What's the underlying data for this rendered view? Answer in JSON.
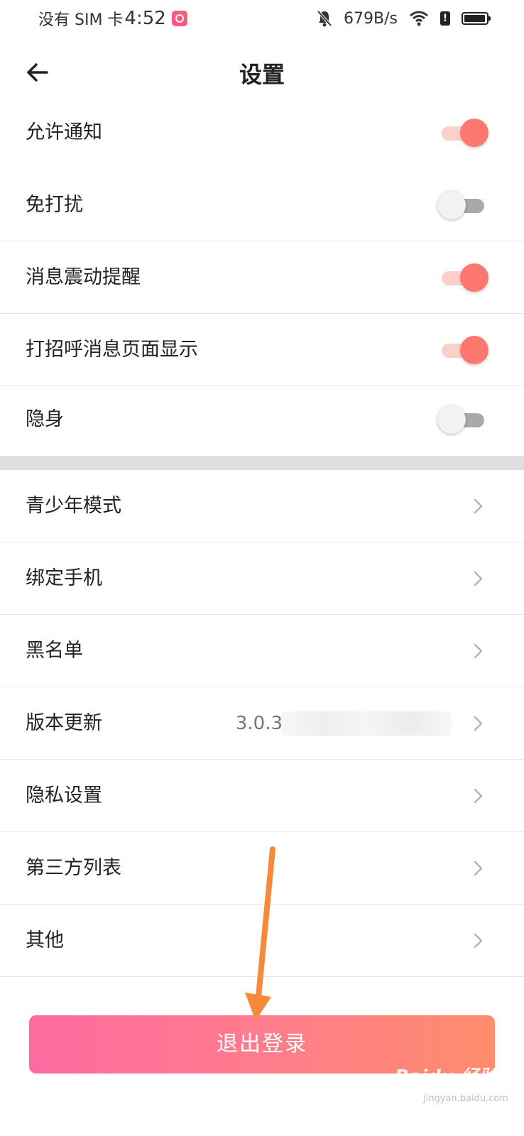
{
  "status_bar": {
    "carrier": "没有 SIM 卡",
    "time": "4:52",
    "net_speed": "679B/s"
  },
  "header": {
    "title": "设置"
  },
  "toggles": [
    {
      "label": "允许通知",
      "on": true
    },
    {
      "label": "免打扰",
      "on": false
    },
    {
      "label": "消息震动提醒",
      "on": true
    },
    {
      "label": "打招呼消息页面显示",
      "on": true
    },
    {
      "label": "隐身",
      "on": false
    }
  ],
  "menu": [
    {
      "label": "青少年模式"
    },
    {
      "label": "绑定手机"
    },
    {
      "label": "黑名单"
    },
    {
      "label": "版本更新",
      "value": "3.0.3"
    },
    {
      "label": "隐私设置"
    },
    {
      "label": "第三方列表"
    },
    {
      "label": "其他"
    }
  ],
  "logout_label": "退出登录",
  "watermark": {
    "brand": "Baidu 经验",
    "url": "jingyan.baidu.com"
  },
  "colors": {
    "accent": "#ff7870",
    "logout_start": "#ff6aa0",
    "logout_end": "#ff8c6c",
    "annotation_arrow": "#f58a3a"
  },
  "icons": {
    "back": "arrow-left-icon",
    "chevron": "chevron-right-icon",
    "bell_muted": "bell-off-icon",
    "wifi": "wifi-icon",
    "battery": "battery-icon"
  }
}
